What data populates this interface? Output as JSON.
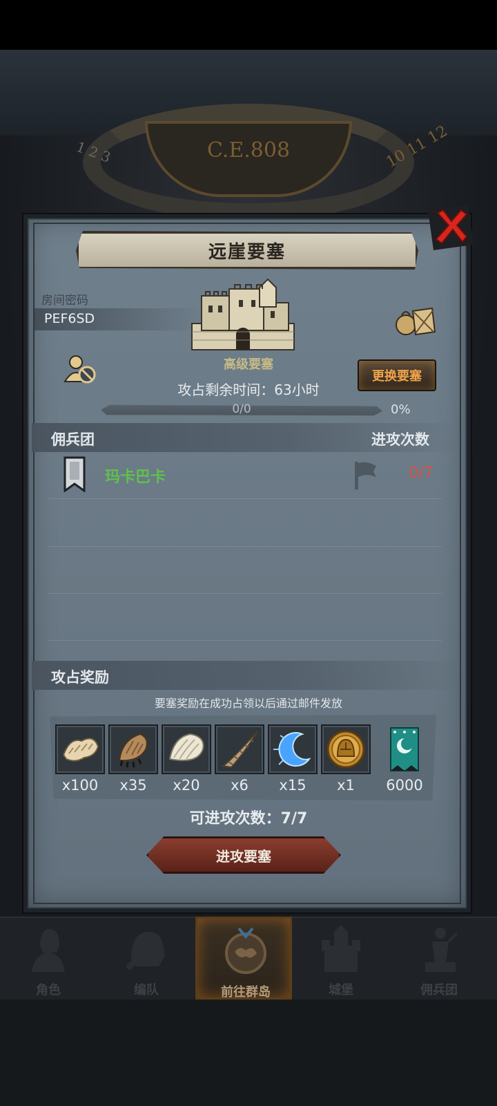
{
  "calendar": {
    "year": "C.E.808",
    "left_numbers": "1 2 3",
    "right_numbers": "10 11 12"
  },
  "dialog": {
    "title": "远崖要塞",
    "room_password_label": "房间密码",
    "room_password": "PEF6SD",
    "fortress_level": "高级要塞",
    "change_fortress_button": "更换要塞",
    "time_left": "攻占剩余时间：63小时",
    "progress": {
      "text": "0/0",
      "percent_text": "0%",
      "percent": 0
    },
    "mercenary_header": "佣兵团",
    "attack_count_header": "进攻次数",
    "mercenaries": [
      {
        "name": "玛卡巴卡",
        "attacks": "0/7"
      }
    ],
    "rewards_header": "攻占奖励",
    "reward_note": "要塞奖励在成功占领以后通过邮件发放",
    "rewards": [
      {
        "icon": "fur-pelt-icon",
        "qty": "x100"
      },
      {
        "icon": "claw-paw-icon",
        "qty": "x35"
      },
      {
        "icon": "white-fur-icon",
        "qty": "x20"
      },
      {
        "icon": "horn-icon",
        "qty": "x6"
      },
      {
        "icon": "blue-crescent-icon",
        "qty": "x15"
      },
      {
        "icon": "gold-helmet-coin-icon",
        "qty": "x1"
      },
      {
        "icon": "teal-banner-icon",
        "qty": "6000"
      }
    ],
    "available_attacks": "可进攻次数：7/7",
    "attack_button": "进攻要塞"
  },
  "nav": [
    {
      "label": "角色",
      "icon": "knight-bust-icon"
    },
    {
      "label": "编队",
      "icon": "helmet-icon"
    },
    {
      "label": "前往群岛",
      "icon": "world-emblem-icon",
      "active": true
    },
    {
      "label": "城堡",
      "icon": "castle-icon"
    },
    {
      "label": "佣兵团",
      "icon": "statue-icon"
    }
  ],
  "colors": {
    "panel": "#6f7f8c",
    "mercenary_name": "#5ec24c",
    "attack_count": "#d6524a",
    "change_button_text": "#f0a34a",
    "attack_button": "#8a3d2e"
  }
}
